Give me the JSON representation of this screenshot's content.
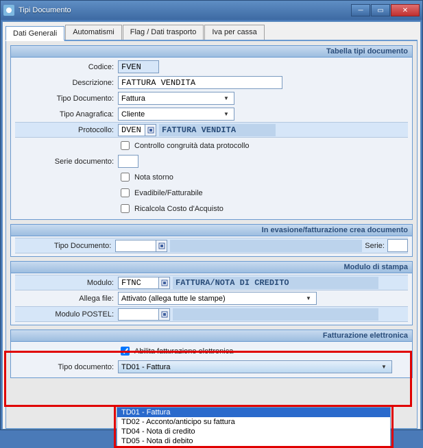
{
  "titlebar": {
    "title": "Tipi Documento"
  },
  "tabs": {
    "dati_generali": "Dati Generali",
    "automatismi": "Automatismi",
    "flag_dati_trasporto": "Flag / Dati trasporto",
    "iva_per_cassa": "Iva per cassa"
  },
  "panel1": {
    "header": "Tabella tipi documento",
    "codice_label": "Codice:",
    "codice_value": "FVEN",
    "descrizione_label": "Descrizione:",
    "descrizione_value": "FATTURA VENDITA",
    "tipo_documento_label": "Tipo Documento:",
    "tipo_documento_value": "Fattura",
    "tipo_anagrafica_label": "Tipo Anagrafica:",
    "tipo_anagrafica_value": "Cliente",
    "protocollo_label": "Protocollo:",
    "protocollo_code": "DVEN",
    "protocollo_desc": "FATTURA VENDITA",
    "chk_controllo": "Controllo congruità data protocollo",
    "serie_label": "Serie documento:",
    "serie_value": "",
    "chk_nota_storno": "Nota storno",
    "chk_evadibile": "Evadibile/Fatturabile",
    "chk_ricalcola": "Ricalcola Costo d'Acquisto"
  },
  "panel2": {
    "header": "In evasione/fatturazione crea documento",
    "tipo_documento_label": "Tipo Documento:",
    "tipo_documento_code": "",
    "tipo_documento_desc": "",
    "serie_label": "Serie:",
    "serie_value": ""
  },
  "panel3": {
    "header": "Modulo di stampa",
    "modulo_label": "Modulo:",
    "modulo_code": "FTNC",
    "modulo_desc": "FATTURA/NOTA DI CREDITO",
    "allega_label": "Allega file:",
    "allega_value": "Attivato (allega tutte le stampe)",
    "postel_label": "Modulo POSTEL:",
    "postel_code": "",
    "postel_desc": ""
  },
  "panel4": {
    "header": "Fatturazione elettronica",
    "chk_abilita": "Abilita fatturazione elettronica",
    "tipo_documento_label": "Tipo documento:",
    "tipo_documento_value": "TD01 - Fattura",
    "options": [
      "TD01 - Fattura",
      "TD02 - Acconto/anticipo su fattura",
      "TD04 - Nota di credito",
      "TD05 - Nota di debito"
    ]
  }
}
